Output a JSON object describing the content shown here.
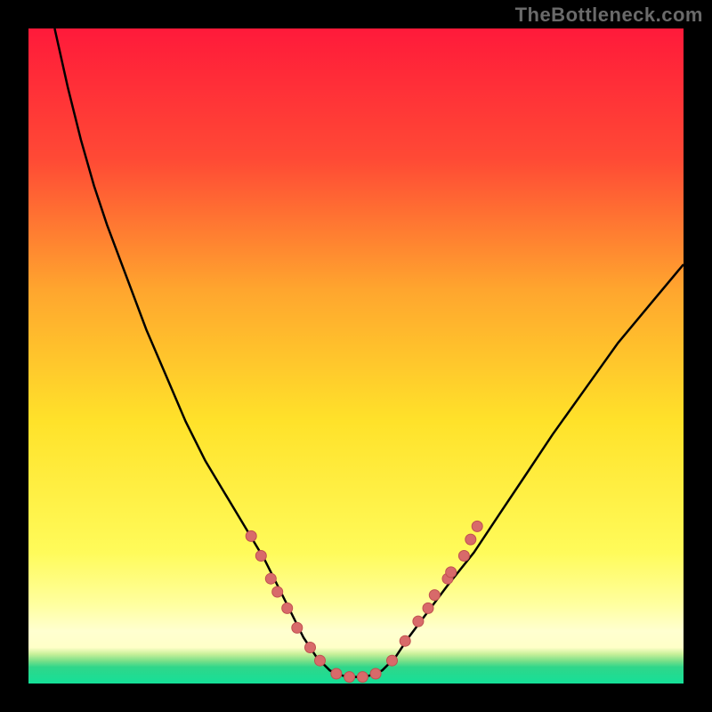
{
  "watermark": "TheBottleneck.com",
  "colors": {
    "frame_bg": "#000000",
    "gradient_stops": [
      {
        "pos": 0.0,
        "color": "#ff1a3a"
      },
      {
        "pos": 0.2,
        "color": "#ff4a35"
      },
      {
        "pos": 0.4,
        "color": "#ffa62e"
      },
      {
        "pos": 0.6,
        "color": "#ffe22a"
      },
      {
        "pos": 0.8,
        "color": "#fffb5a"
      },
      {
        "pos": 0.88,
        "color": "#ffffa0"
      },
      {
        "pos": 0.92,
        "color": "#ffffd0"
      },
      {
        "pos": 0.945,
        "color": "#ffffc8"
      },
      {
        "pos": 0.955,
        "color": "#c8f09a"
      },
      {
        "pos": 0.965,
        "color": "#7de089"
      },
      {
        "pos": 0.975,
        "color": "#2fd68a"
      },
      {
        "pos": 1.0,
        "color": "#15e098"
      }
    ],
    "curve_stroke": "#000000",
    "marker_fill": "#d86a6a",
    "marker_stroke": "#c05050"
  },
  "chart_data": {
    "type": "line",
    "title": "",
    "subtitle": "",
    "xlabel": "",
    "ylabel": "",
    "xlim": [
      0,
      100
    ],
    "ylim": [
      0,
      100
    ],
    "note": "x and y are normalized 0-100 (percent of plot area, origin bottom-left). Values estimated from pixels; no numeric axes in source image.",
    "series": [
      {
        "name": "v-curve-left",
        "x": [
          4,
          6,
          8,
          10,
          12,
          15,
          18,
          21,
          24,
          27,
          30,
          33,
          36,
          38,
          40,
          42,
          44,
          46
        ],
        "y": [
          100,
          91,
          83,
          76,
          70,
          62,
          54,
          47,
          40,
          34,
          29,
          24,
          19,
          15,
          11,
          7,
          4,
          2
        ]
      },
      {
        "name": "v-curve-bottom",
        "x": [
          46,
          47,
          48,
          49,
          50,
          51,
          52,
          53,
          54
        ],
        "y": [
          2,
          1.5,
          1.2,
          1.0,
          1.0,
          1.0,
          1.2,
          1.5,
          2
        ]
      },
      {
        "name": "v-curve-right",
        "x": [
          54,
          56,
          58,
          61,
          64,
          68,
          72,
          76,
          80,
          85,
          90,
          95,
          100
        ],
        "y": [
          2,
          4,
          7,
          11,
          15,
          20,
          26,
          32,
          38,
          45,
          52,
          58,
          64
        ]
      }
    ],
    "markers": [
      {
        "name": "left-cluster",
        "x": 34.0,
        "y": 22.5,
        "r": 6
      },
      {
        "name": "left-cluster",
        "x": 35.5,
        "y": 19.5,
        "r": 6
      },
      {
        "name": "left-cluster",
        "x": 37.0,
        "y": 16.0,
        "r": 6
      },
      {
        "name": "left-cluster",
        "x": 38.0,
        "y": 14.0,
        "r": 6
      },
      {
        "name": "left-cluster",
        "x": 39.5,
        "y": 11.5,
        "r": 6
      },
      {
        "name": "left-cluster",
        "x": 41.0,
        "y": 8.5,
        "r": 6
      },
      {
        "name": "left-cluster",
        "x": 43.0,
        "y": 5.5,
        "r": 6
      },
      {
        "name": "left-cluster",
        "x": 44.5,
        "y": 3.5,
        "r": 6
      },
      {
        "name": "bottom",
        "x": 47.0,
        "y": 1.5,
        "r": 6
      },
      {
        "name": "bottom",
        "x": 49.0,
        "y": 1.0,
        "r": 6
      },
      {
        "name": "bottom",
        "x": 51.0,
        "y": 1.0,
        "r": 6
      },
      {
        "name": "bottom",
        "x": 53.0,
        "y": 1.5,
        "r": 6
      },
      {
        "name": "right-cluster",
        "x": 55.5,
        "y": 3.5,
        "r": 6
      },
      {
        "name": "right-cluster",
        "x": 57.5,
        "y": 6.5,
        "r": 6
      },
      {
        "name": "right-cluster",
        "x": 59.5,
        "y": 9.5,
        "r": 6
      },
      {
        "name": "right-cluster",
        "x": 61.0,
        "y": 11.5,
        "r": 6
      },
      {
        "name": "right-cluster",
        "x": 62.0,
        "y": 13.5,
        "r": 6
      },
      {
        "name": "right-cluster",
        "x": 64.0,
        "y": 16.0,
        "r": 6
      },
      {
        "name": "right-cluster",
        "x": 64.5,
        "y": 17.0,
        "r": 6
      },
      {
        "name": "right-cluster",
        "x": 66.5,
        "y": 19.5,
        "r": 6
      },
      {
        "name": "right-cluster",
        "x": 67.5,
        "y": 22.0,
        "r": 6
      },
      {
        "name": "right-cluster",
        "x": 68.5,
        "y": 24.0,
        "r": 6
      }
    ]
  }
}
